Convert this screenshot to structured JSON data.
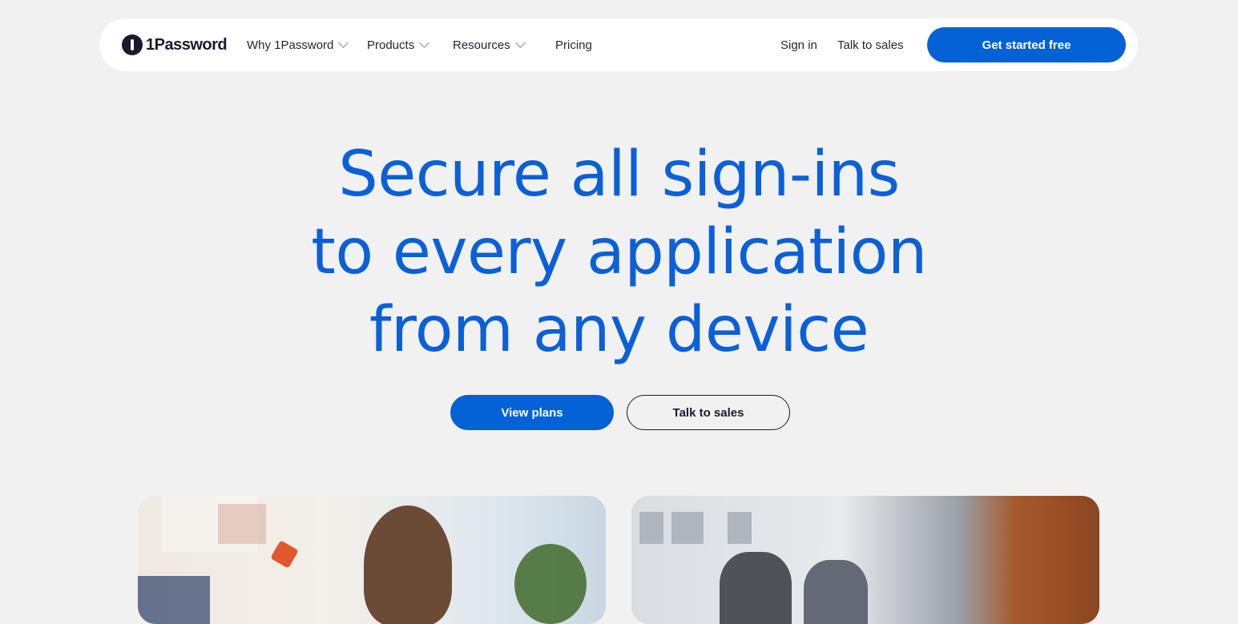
{
  "brand": {
    "name": "1Password"
  },
  "nav": {
    "items": [
      {
        "label": "Why 1Password",
        "dropdown": true
      },
      {
        "label": "Products",
        "dropdown": true
      },
      {
        "label": "Resources",
        "dropdown": true
      },
      {
        "label": "Pricing",
        "dropdown": false
      }
    ],
    "sign_in": "Sign in",
    "talk_to_sales": "Talk to sales",
    "cta": "Get started free"
  },
  "hero": {
    "lines": [
      "Secure all sign-ins",
      "to every application",
      "from any device"
    ],
    "primary_button": "View plans",
    "secondary_button": "Talk to sales"
  },
  "colors": {
    "accent": "#0561d6",
    "headline": "#0a60d8",
    "background": "#f1f1f1",
    "dark": "#1a1a2e"
  },
  "icons": [
    "logo-keyhole-icon",
    "chevron-down-icon"
  ]
}
